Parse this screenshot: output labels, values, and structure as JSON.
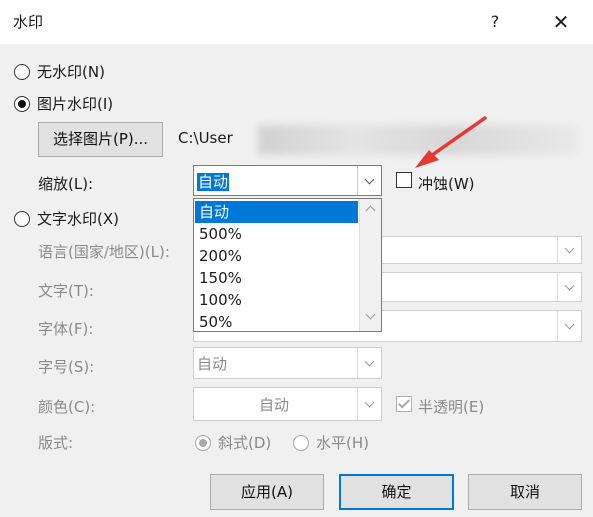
{
  "window": {
    "title": "水印",
    "help": "?",
    "close": "✕"
  },
  "options": {
    "none": "无水印(N)",
    "picture": "图片水印(I)",
    "text": "文字水印(X)"
  },
  "picture": {
    "select_button": "选择图片(P)...",
    "path": "C:\\User",
    "scale_label": "缩放(L):",
    "scale_value": "自动",
    "washout_label": "冲蚀(W)",
    "scale_options": [
      "自动",
      "500%",
      "200%",
      "150%",
      "100%",
      "50%"
    ]
  },
  "text": {
    "language_label": "语言(国家/地区)(L):",
    "text_label": "文字(T):",
    "font_label": "字体(F):",
    "size_label": "字号(S):",
    "size_value": "自动",
    "color_label": "颜色(C):",
    "color_value": "自动",
    "semitransparent_label": "半透明(E)",
    "layout_label": "版式:",
    "diagonal": "斜式(D)",
    "horizontal": "水平(H)"
  },
  "buttons": {
    "apply": "应用(A)",
    "ok": "确定",
    "cancel": "取消"
  },
  "colors": {
    "accent": "#0078d7",
    "annotation": "#e53935"
  }
}
